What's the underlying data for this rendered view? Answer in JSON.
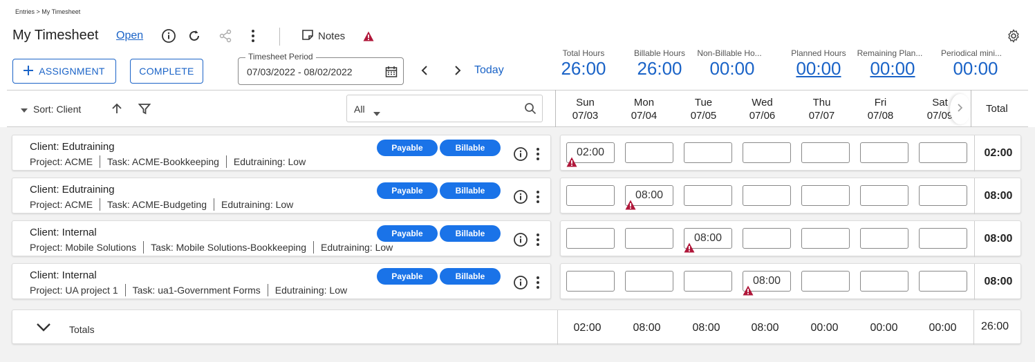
{
  "breadcrumb": "Entries > My Timesheet",
  "title": "My Timesheet",
  "status": "Open",
  "notes_label": "Notes",
  "buttons": {
    "assignment": "ASSIGNMENT",
    "complete": "COMPLETE"
  },
  "period": {
    "label": "Timesheet Period",
    "value": "07/03/2022 - 08/02/2022"
  },
  "today": "Today",
  "stats": [
    {
      "label": "Total Hours",
      "value": "26:00",
      "link": false
    },
    {
      "label": "Billable Hours",
      "value": "26:00",
      "link": false
    },
    {
      "label": "Non-Billable Ho...",
      "value": "00:00",
      "link": false
    },
    {
      "label": "Planned Hours",
      "value": "00:00",
      "link": true
    },
    {
      "label": "Remaining Plan...",
      "value": "00:00",
      "link": true
    },
    {
      "label": "Periodical mini...",
      "value": "00:00",
      "link": false
    }
  ],
  "sort_label": "Sort: Client",
  "filter_value": "All",
  "days": [
    {
      "dow": "Sun",
      "date": "07/03"
    },
    {
      "dow": "Mon",
      "date": "07/04"
    },
    {
      "dow": "Tue",
      "date": "07/05"
    },
    {
      "dow": "Wed",
      "date": "07/06"
    },
    {
      "dow": "Thu",
      "date": "07/07"
    },
    {
      "dow": "Fri",
      "date": "07/08"
    },
    {
      "dow": "Sat",
      "date": "07/09"
    }
  ],
  "total_header": "Total",
  "pills": {
    "payable": "Payable",
    "billable": "Billable"
  },
  "rows": [
    {
      "client": "Client: Edutraining",
      "project": "Project: ACME",
      "task": "Task: ACME-Bookkeeping",
      "level": "Edutraining: Low",
      "hours": [
        "02:00",
        "",
        "",
        "",
        "",
        "",
        ""
      ],
      "total": "02:00"
    },
    {
      "client": "Client: Edutraining",
      "project": "Project: ACME",
      "task": "Task: ACME-Budgeting",
      "level": "Edutraining: Low",
      "hours": [
        "",
        "08:00",
        "",
        "",
        "",
        "",
        ""
      ],
      "total": "08:00"
    },
    {
      "client": "Client: Internal",
      "project": "Project: Mobile Solutions",
      "task": "Task: Mobile Solutions-Bookkeeping",
      "level": "Edutraining: Low",
      "hours": [
        "",
        "",
        "08:00",
        "",
        "",
        "",
        ""
      ],
      "total": "08:00"
    },
    {
      "client": "Client: Internal",
      "project": "Project: UA project 1",
      "task": "Task: ua1-Government Forms",
      "level": "Edutraining: Low",
      "hours": [
        "",
        "",
        "",
        "08:00",
        "",
        "",
        ""
      ],
      "total": "08:00"
    }
  ],
  "totals": {
    "label": "Totals",
    "days": [
      "02:00",
      "08:00",
      "08:00",
      "08:00",
      "00:00",
      "00:00",
      "00:00"
    ],
    "grand": "26:00"
  },
  "colors": {
    "accent": "#1a63c7",
    "pill": "#1a73e8",
    "warning": "#b0173a"
  }
}
